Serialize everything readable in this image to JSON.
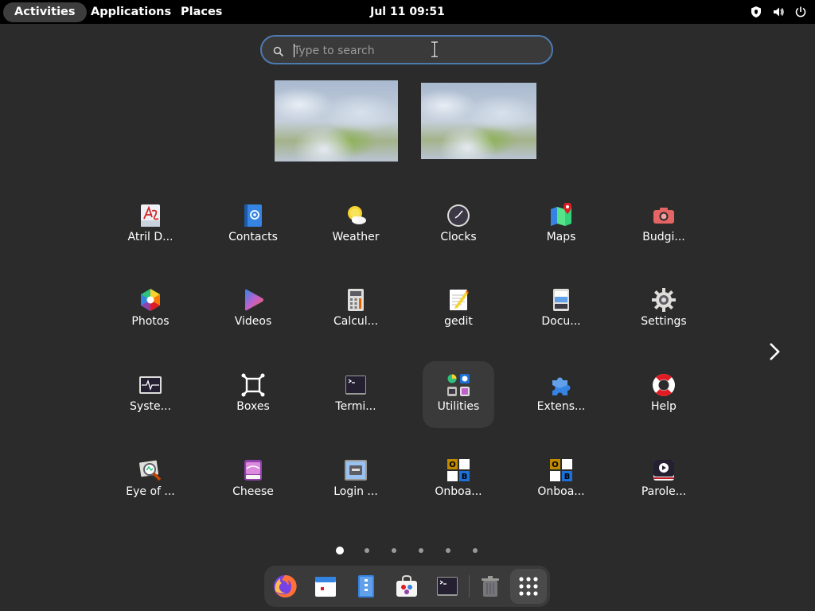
{
  "topbar": {
    "activities": "Activities",
    "applications": "Applications",
    "places": "Places",
    "clock": "Jul 11  09:51"
  },
  "search": {
    "placeholder": "Type to search",
    "value": ""
  },
  "pages": {
    "count": 6,
    "current": 1
  },
  "apps": [
    {
      "label": "Atril D...",
      "icon": "atril-document-viewer-icon"
    },
    {
      "label": "Contacts",
      "icon": "contacts-icon"
    },
    {
      "label": "Weather",
      "icon": "weather-icon"
    },
    {
      "label": "Clocks",
      "icon": "clocks-icon"
    },
    {
      "label": "Maps",
      "icon": "maps-icon"
    },
    {
      "label": "Budgi...",
      "icon": "budgie-screenshot-icon"
    },
    {
      "label": "Photos",
      "icon": "photos-icon"
    },
    {
      "label": "Videos",
      "icon": "videos-icon"
    },
    {
      "label": "Calcul...",
      "icon": "calculator-icon"
    },
    {
      "label": "gedit",
      "icon": "gedit-icon"
    },
    {
      "label": "Docu...",
      "icon": "document-scanner-icon"
    },
    {
      "label": "Settings",
      "icon": "settings-gear-icon"
    },
    {
      "label": "Syste...",
      "icon": "system-monitor-icon"
    },
    {
      "label": "Boxes",
      "icon": "boxes-icon"
    },
    {
      "label": "Termi...",
      "icon": "terminal-icon"
    },
    {
      "label": "Utilities",
      "icon": "utilities-folder-icon"
    },
    {
      "label": "Extens...",
      "icon": "extensions-puzzle-icon"
    },
    {
      "label": "Help",
      "icon": "help-lifebuoy-icon"
    },
    {
      "label": "Eye of ...",
      "icon": "eye-of-gnome-icon"
    },
    {
      "label": "Cheese",
      "icon": "cheese-icon"
    },
    {
      "label": "Login ...",
      "icon": "login-window-icon"
    },
    {
      "label": "Onboa...",
      "icon": "onboard-keyboard-icon"
    },
    {
      "label": "Onboa...",
      "icon": "onboard-settings-icon"
    },
    {
      "label": "Parole...",
      "icon": "parole-media-player-icon"
    }
  ],
  "dock": [
    "firefox-icon",
    "calendar-icon",
    "file-manager-icon",
    "software-store-icon",
    "terminal-icon",
    "trash-icon",
    "show-apps-grid-icon"
  ],
  "colors": {
    "accent": "#4e7ab2",
    "background": "#2b2b2b",
    "topbar": "#000000"
  }
}
